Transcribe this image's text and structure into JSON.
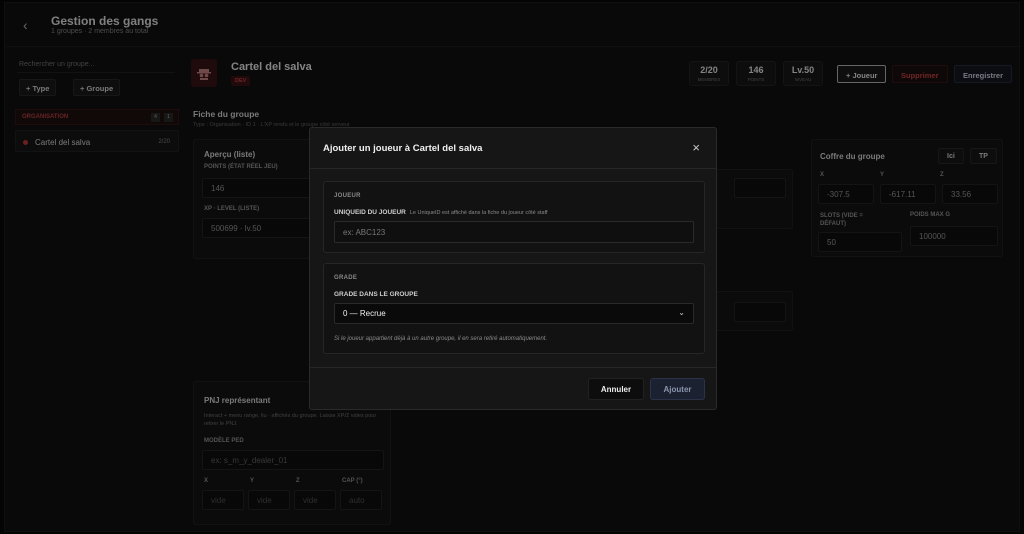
{
  "header": {
    "back_glyph": "‹",
    "title": "Gestion des gangs",
    "subtitle": "1 groupes · 2 membres au total"
  },
  "sidebar": {
    "search_placeholder": "Rechercher un groupe...",
    "add_type_label": "+ Type",
    "add_group_label": "+ Groupe",
    "org_header": {
      "label": "ORGANISATION",
      "badge_a": "4",
      "badge_b": "1"
    },
    "items": [
      {
        "name": "Cartel del salva",
        "count": "2/20"
      }
    ]
  },
  "group": {
    "icon": "spy-icon",
    "name": "Cartel del salva",
    "tag": "DEV",
    "stats": [
      {
        "value": "2/20",
        "label": "MEMBRES"
      },
      {
        "value": "146",
        "label": "POINTS"
      },
      {
        "value": "Lv.50",
        "label": "NIVEAU"
      }
    ],
    "add_player_label": "+ Joueur",
    "delete_label": "Supprimer",
    "save_label": "Enregistrer"
  },
  "sheet": {
    "title": "Fiche du groupe",
    "subtitle": "Type : Organisation · ID 1 · L'XP rendu et le groupe côté serveur",
    "overview": {
      "title": "Aperçu (liste)",
      "points_label": "POINTS (ÉTAT RÉEL JEU)",
      "points_value": "146",
      "xp_label": "XP · LEVEL (LISTE)",
      "xp_value": "500699 · lv.50"
    },
    "chest": {
      "title": "Coffre du groupe",
      "here_label": "Ici",
      "tp_label": "TP",
      "x_label": "X",
      "y_label": "Y",
      "z_label": "Z",
      "x_value": "-307.5",
      "y_value": "-617.11",
      "z_value": "33.56",
      "slots_label": "SLOTS (VIDE = DÉFAUT)",
      "weight_label": "POIDS MAX G",
      "slots_value": "50",
      "weight_value": "100000"
    },
    "npc": {
      "title": "PNJ représentant",
      "desc": "Interact + menu range, liu · affichés du groupe. Laisse XP/Z vides pour retirer le PNJ.",
      "model_label": "MODÈLE PED",
      "model_placeholder": "ex: s_m_y_dealer_01",
      "x_label": "X",
      "y_label": "Y",
      "z_label": "Z",
      "cap_label": "CAP (°)",
      "empty": "vide",
      "auto": "auto"
    }
  },
  "modal": {
    "title": "Ajouter un joueur à Cartel del salva",
    "close_glyph": "×",
    "player_section": "JOUEUR",
    "uid_label": "UNIQUEID DU JOUEUR",
    "uid_hint": "Le UniqueID est affiché dans la fiche du joueur côté staff",
    "uid_placeholder": "ex: ABC123",
    "grade_section": "GRADE",
    "grade_label": "GRADE DANS LE GROUPE",
    "grade_value": "0 — Recrue",
    "chevron": "⌄",
    "grade_note": "Si le joueur appartient déjà à un autre groupe, il en sera retiré automatiquement.",
    "cancel_label": "Annuler",
    "submit_label": "Ajouter"
  },
  "colors": {
    "accent_red": "#c23b3b",
    "background": "#121212"
  }
}
